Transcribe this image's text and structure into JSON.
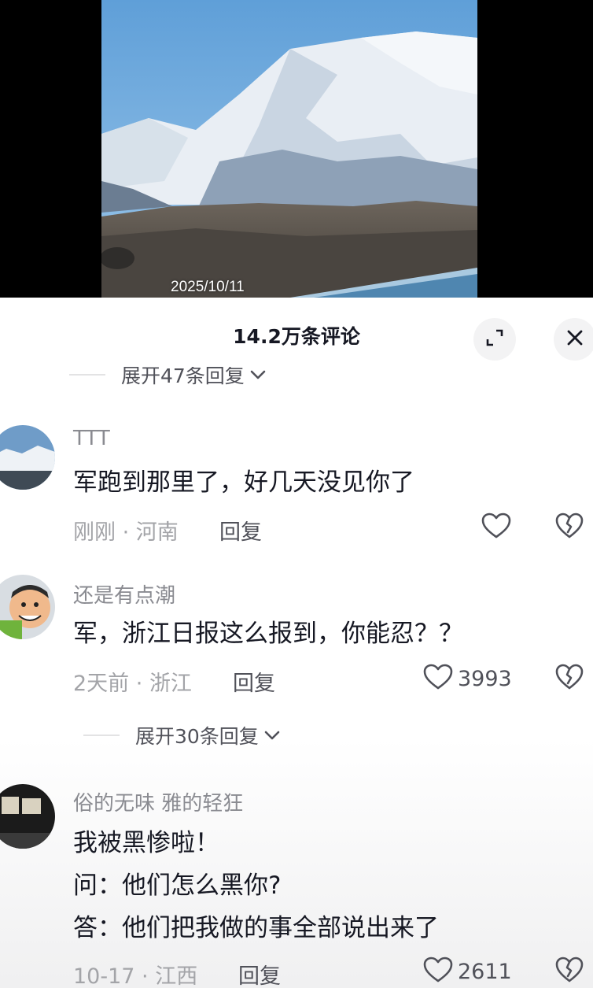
{
  "video": {
    "date_stamp": "2025/10/11"
  },
  "panel": {
    "title": "14.2万条评论",
    "collapsed_replies_label": "展开47条回复"
  },
  "comments": [
    {
      "username": "TTT",
      "text": "军跑到那里了，好几天没见你了",
      "time": "刚刚",
      "location": "河南",
      "reply_label": "回复",
      "likes": ""
    },
    {
      "username": "还是有点潮",
      "text": "军，浙江日报这么报到，你能忍？？",
      "time": "2天前",
      "location": "浙江",
      "reply_label": "回复",
      "likes": "3993",
      "expand_label": "展开30条回复"
    },
    {
      "username": "俗的无味  雅的轻狂",
      "lines": [
        "我被黑惨啦！",
        "问：他们怎么黑你?",
        "答：他们把我做的事全部说出来了"
      ],
      "time": "10-17",
      "location": "江西",
      "reply_label": "回复",
      "likes": "2611"
    }
  ],
  "separator": " · ",
  "colors": {
    "text_primary": "#161823",
    "text_secondary": "#8a8b91",
    "meta": "#a3a4a8",
    "button_bg": "#f3f3f4"
  },
  "icons": [
    "expand-icon",
    "close-icon",
    "chevron-down-icon",
    "heart-icon",
    "broken-heart-icon"
  ]
}
